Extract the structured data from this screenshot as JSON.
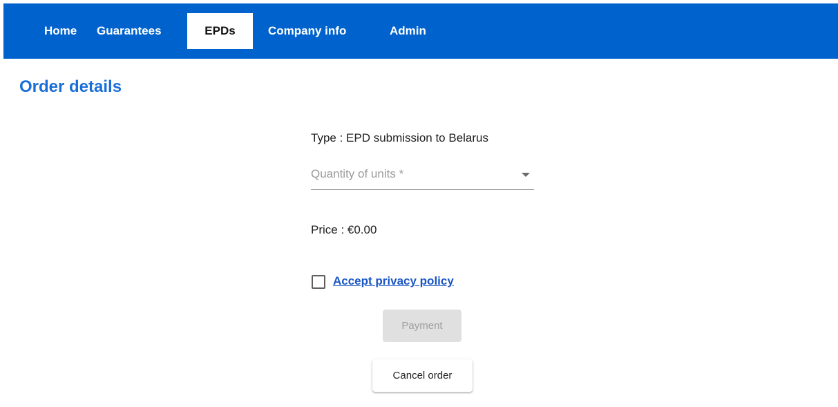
{
  "nav": {
    "items": [
      {
        "label": "Home",
        "active": false
      },
      {
        "label": "Guarantees",
        "active": false
      },
      {
        "label": "EPDs",
        "active": true
      },
      {
        "label": "Company info",
        "active": false
      },
      {
        "label": "Admin",
        "active": false
      }
    ],
    "background_color": "#0062cc"
  },
  "page": {
    "title": "Order details",
    "title_color": "#1a6ed8"
  },
  "order": {
    "type_text": "Type : EPD submission to Belarus",
    "quantity": {
      "placeholder": "Quantity of units *",
      "value": ""
    },
    "price_text": "Price : €0.00",
    "privacy": {
      "label": "Accept privacy policy",
      "checked": false
    },
    "payment_label": "Payment",
    "payment_disabled": true,
    "cancel_label": "Cancel order"
  },
  "icons": {
    "dropdown": "chevron-down-icon",
    "checkbox": "checkbox-unchecked-icon"
  }
}
